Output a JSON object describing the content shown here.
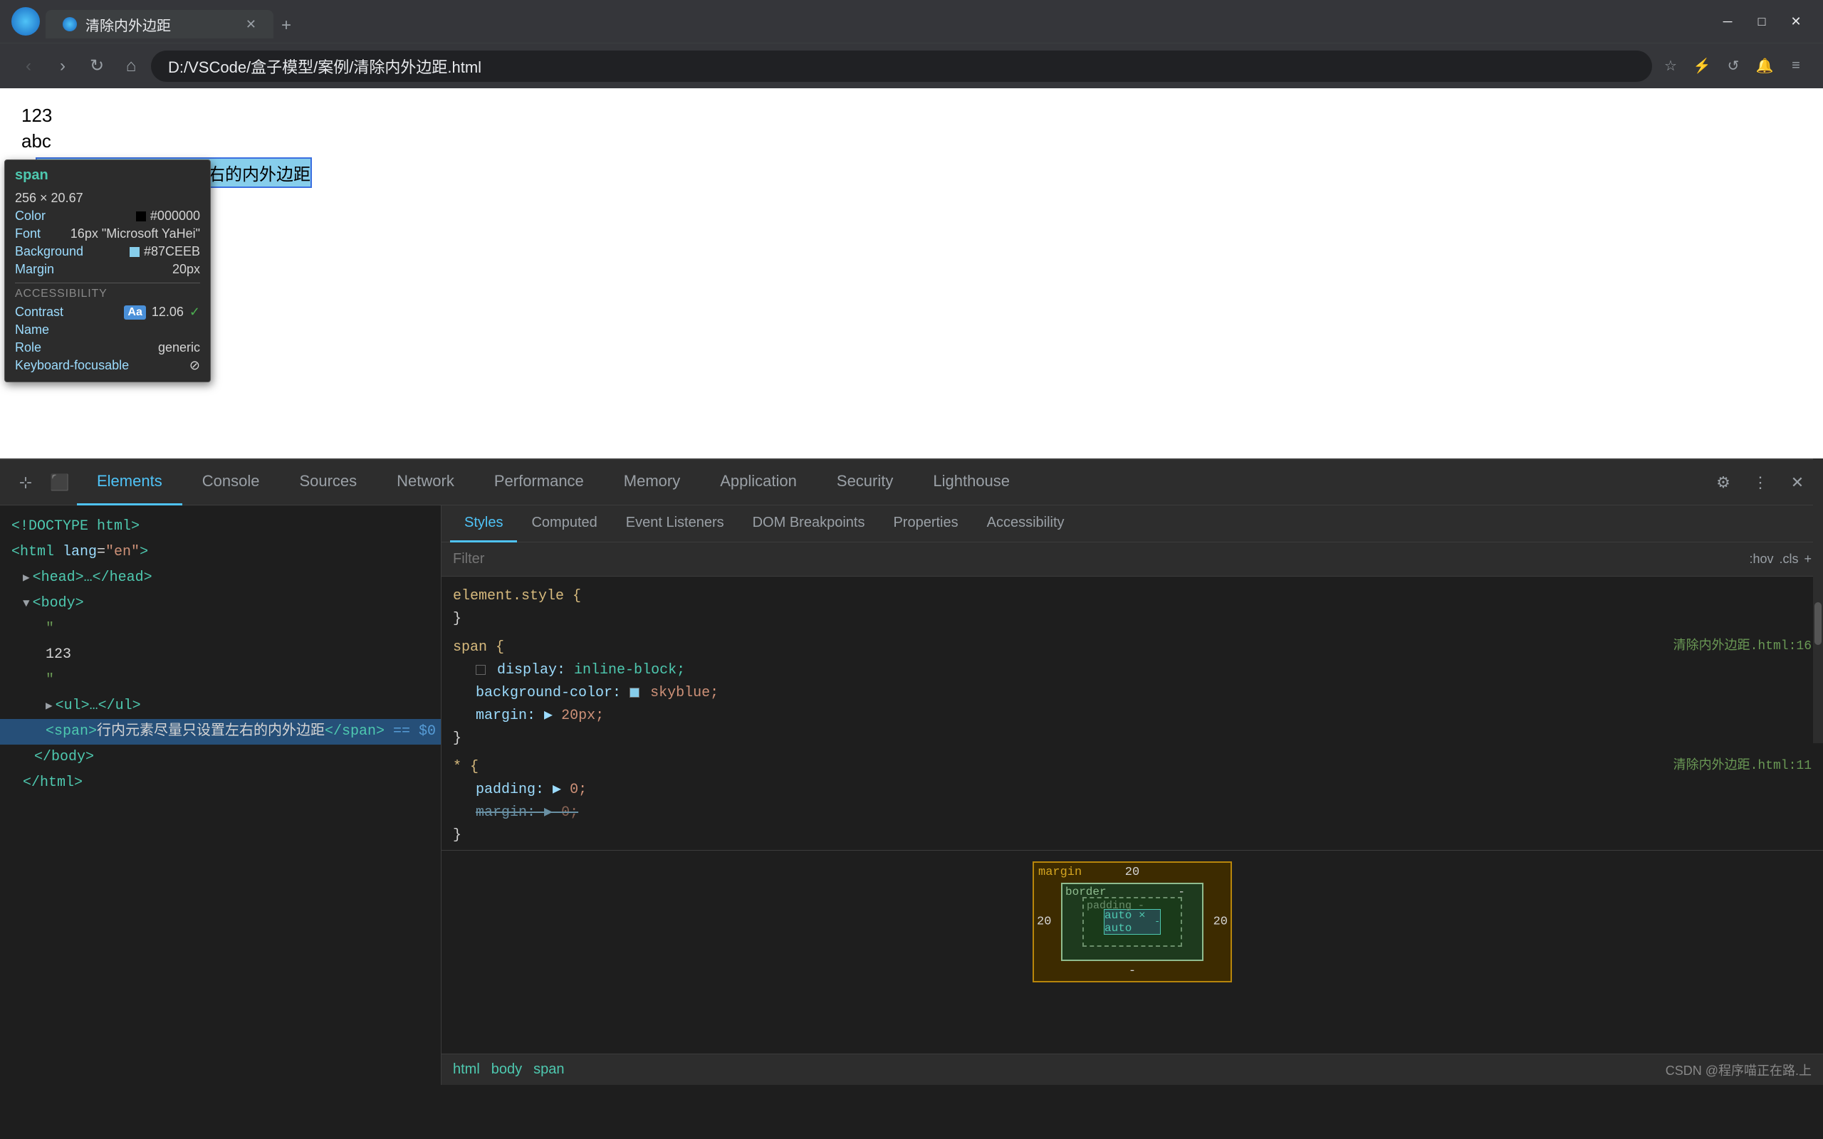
{
  "browser": {
    "title": "清除内外边距",
    "url": "D:/VSCode/盒子模型/案例/清除内外边距.html",
    "new_tab_label": "+",
    "window_controls": [
      "─",
      "□",
      "✕"
    ],
    "nav_back": "‹",
    "nav_forward": "›",
    "nav_refresh": "↻",
    "nav_home": "⌂"
  },
  "page": {
    "text1": "123",
    "text2": "abc",
    "span_text": "行内元素尽量只设置左右的内外边距"
  },
  "tooltip": {
    "tag": "span",
    "size": "256 × 20.67",
    "color_label": "Color",
    "color_value": "#000000",
    "font_label": "Font",
    "font_value": "16px \"Microsoft YaHei\"",
    "background_label": "Background",
    "background_value": "#87CEEB",
    "margin_label": "Margin",
    "margin_value": "20px",
    "accessibility_title": "ACCESSIBILITY",
    "contrast_label": "Contrast",
    "contrast_aa": "Aa",
    "contrast_value": "12.06",
    "name_label": "Name",
    "name_value": "",
    "role_label": "Role",
    "role_value": "generic",
    "keyboard_label": "Keyboard-focusable",
    "keyboard_value": "⊘"
  },
  "devtools": {
    "tabs": [
      "Elements",
      "Console",
      "Sources",
      "Network",
      "Performance",
      "Memory",
      "Application",
      "Security",
      "Lighthouse"
    ],
    "active_tab": "Elements",
    "styles_tabs": [
      "Styles",
      "Computed",
      "Event Listeners",
      "DOM Breakpoints",
      "Properties",
      "Accessibility"
    ],
    "active_styles_tab": "Styles",
    "filter_placeholder": "Filter",
    "filter_hov": ":hov",
    "filter_cls": ".cls",
    "filter_plus": "+",
    "dom": {
      "lines": [
        "<!DOCTYPE html>",
        "<html lang=\"en\">",
        "  ▶ <head>…</head>",
        "  ▼ <body>",
        "      \"",
        "      123",
        "      \"",
        "      ▶ <ul>…</ul>",
        "      <span>行内元素尽量只设置左右的内外边距</span> == $0",
        "    </body>",
        "  </html>"
      ]
    },
    "css_rules": [
      {
        "selector": "element.style {",
        "properties": [],
        "close": "}"
      },
      {
        "selector": "span {",
        "source": "清除内外边距.html:16",
        "properties": [
          {
            "prop": "display:",
            "value": "inline-block;",
            "strikethrough": false,
            "checkbox": true,
            "checked": false
          },
          {
            "prop": "background-color:",
            "value": "skyblue;",
            "strikethrough": false,
            "color": "skyblue"
          },
          {
            "prop": "margin:",
            "value": "20px;",
            "strikethrough": false
          }
        ],
        "close": "}"
      },
      {
        "selector": "* {",
        "source": "清除内外边距.html:11",
        "properties": [
          {
            "prop": "padding:",
            "value": "▶ 0;",
            "strikethrough": false
          },
          {
            "prop": "margin:",
            "value": "▶ 0;",
            "strikethrough": true
          }
        ],
        "close": "}"
      }
    ],
    "box_model": {
      "margin_label": "margin",
      "margin_top": "20",
      "margin_right": "20",
      "margin_bottom": "-",
      "margin_left": "20",
      "border_label": "border",
      "border_value": "-",
      "padding_label": "padding",
      "padding_value": "-",
      "content": "auto × auto",
      "content_sub": "-"
    },
    "breadcrumb": [
      "html",
      "body",
      "span"
    ],
    "copyright": "CSDN @程序喵正在路.上"
  }
}
